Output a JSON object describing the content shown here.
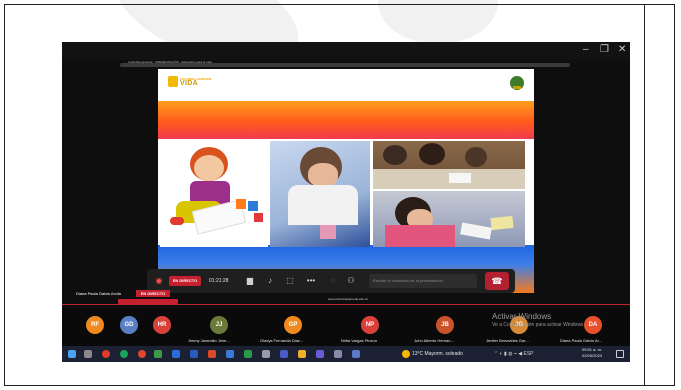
{
  "window": {
    "minimize": "–",
    "maximize": "❐",
    "close": "✕",
    "tab_text": "Colombia Aprende · PRESENTACIÓN · Educación para la vida"
  },
  "slide": {
    "logo_small": "COLOMBIA APRENDE",
    "logo_main": "VIDA",
    "footer_url": "www.colombiaaprende.edu.co"
  },
  "controls": {
    "live_label": "EN DIRECTO",
    "timer": "01:21:28",
    "notes_placeholder": "Escribir el contenido de la presentación",
    "camera_icon": "camera-icon",
    "mic_icon": "mic-icon",
    "share_icon": "share-icon",
    "more_icon": "more-icon",
    "react_icon": "reaction-icon",
    "people_icon": "people-icon",
    "end_icon": "hangup-icon"
  },
  "presenter": {
    "name": "Diana Paola Galvis Arcila",
    "live_label": "EN DIRECTO"
  },
  "participants": [
    {
      "initials": "RF",
      "name": "",
      "color": "#f08a1e"
    },
    {
      "initials": "GD",
      "name": "",
      "color": "#5b7fc4"
    },
    {
      "initials": "HR",
      "name": "",
      "color": "#d8413a"
    },
    {
      "initials": "JJ",
      "name": "Jimmy Jaramillo Jime...",
      "color": "#6b7a3a"
    },
    {
      "initials": "GP",
      "name": "Gladys Fernanda Diaz...",
      "color": "#f08a1e"
    },
    {
      "initials": "NP",
      "name": "Nidia Vargas Pinzon",
      "color": "#d8413a"
    },
    {
      "initials": "JB",
      "name": "John Alberto Hernan...",
      "color": "#c9532a"
    },
    {
      "initials": "JG",
      "name": "Jenifer Benavides Gar...",
      "color": "#d78a35"
    },
    {
      "initials": "DA",
      "name": "Diana Paola Galvis Ar...",
      "color": "#e8502a"
    }
  ],
  "activate_windows": {
    "title": "Activar Windows",
    "subtitle": "Ve a Configuración para activar Windows"
  },
  "taskbar": {
    "weather": "13°C Mayorm. soleado",
    "tray_text": "ESP",
    "time": "09:51 a. m.",
    "date": "02/06/2023"
  }
}
